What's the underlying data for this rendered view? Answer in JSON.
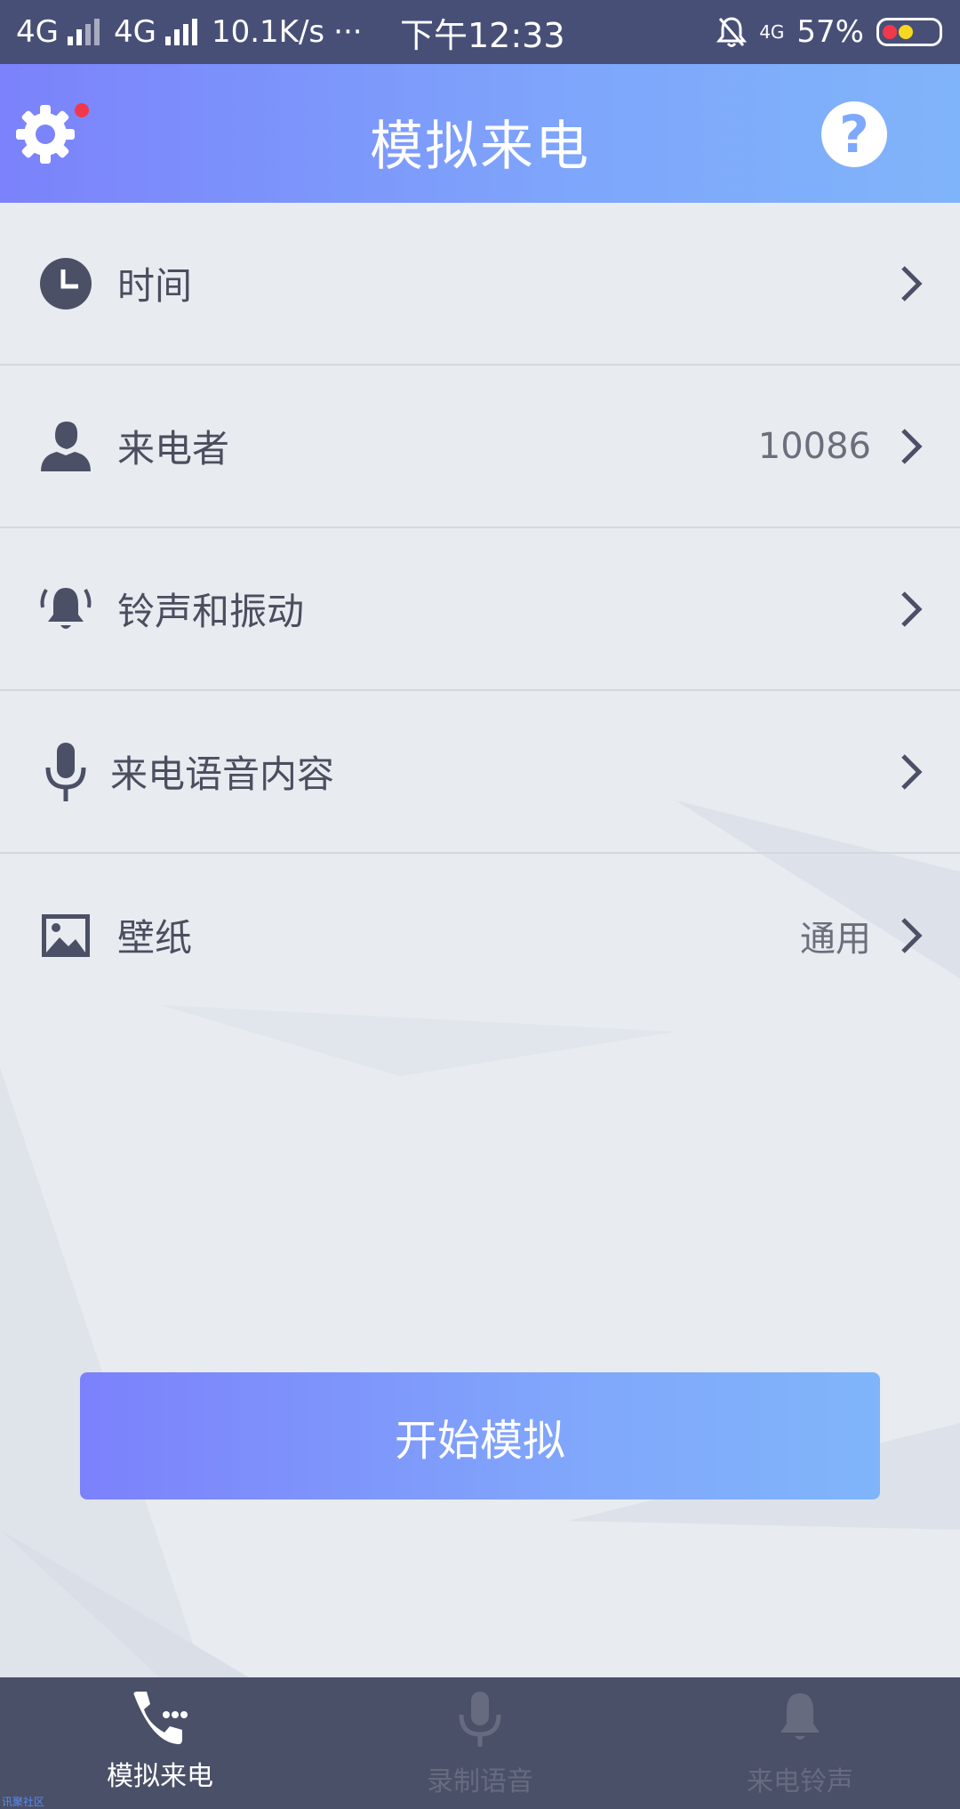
{
  "status_bar": {
    "network1": "4G",
    "network2": "4G",
    "speed": "10.1K/s",
    "dots": "···",
    "time": "下午12:33",
    "network_badge": "4G",
    "battery": "57%"
  },
  "header": {
    "title": "模拟来电",
    "help_label": "?"
  },
  "menu": {
    "items": [
      {
        "label": "时间",
        "value": "",
        "icon": "clock-icon"
      },
      {
        "label": "来电者",
        "value": "10086",
        "icon": "person-icon"
      },
      {
        "label": "铃声和振动",
        "value": "",
        "icon": "bell-icon"
      },
      {
        "label": "来电语音内容",
        "value": "",
        "icon": "microphone-icon"
      },
      {
        "label": "壁纸",
        "value": "通用",
        "icon": "image-icon"
      }
    ]
  },
  "start_button": {
    "label": "开始模拟"
  },
  "tabbar": {
    "tabs": [
      {
        "label": "模拟来电",
        "icon": "phone-icon",
        "active": true
      },
      {
        "label": "录制语音",
        "icon": "microphone-icon",
        "active": false
      },
      {
        "label": "来电铃声",
        "icon": "bell-icon",
        "active": false
      }
    ]
  },
  "watermark": "讯聚社区",
  "colors": {
    "status_bar": "#484f77",
    "header_gradient_start": "#7b82fb",
    "header_gradient_end": "#80b4fa",
    "tabbar": "#4a5068",
    "notification_dot": "#f2384b"
  }
}
